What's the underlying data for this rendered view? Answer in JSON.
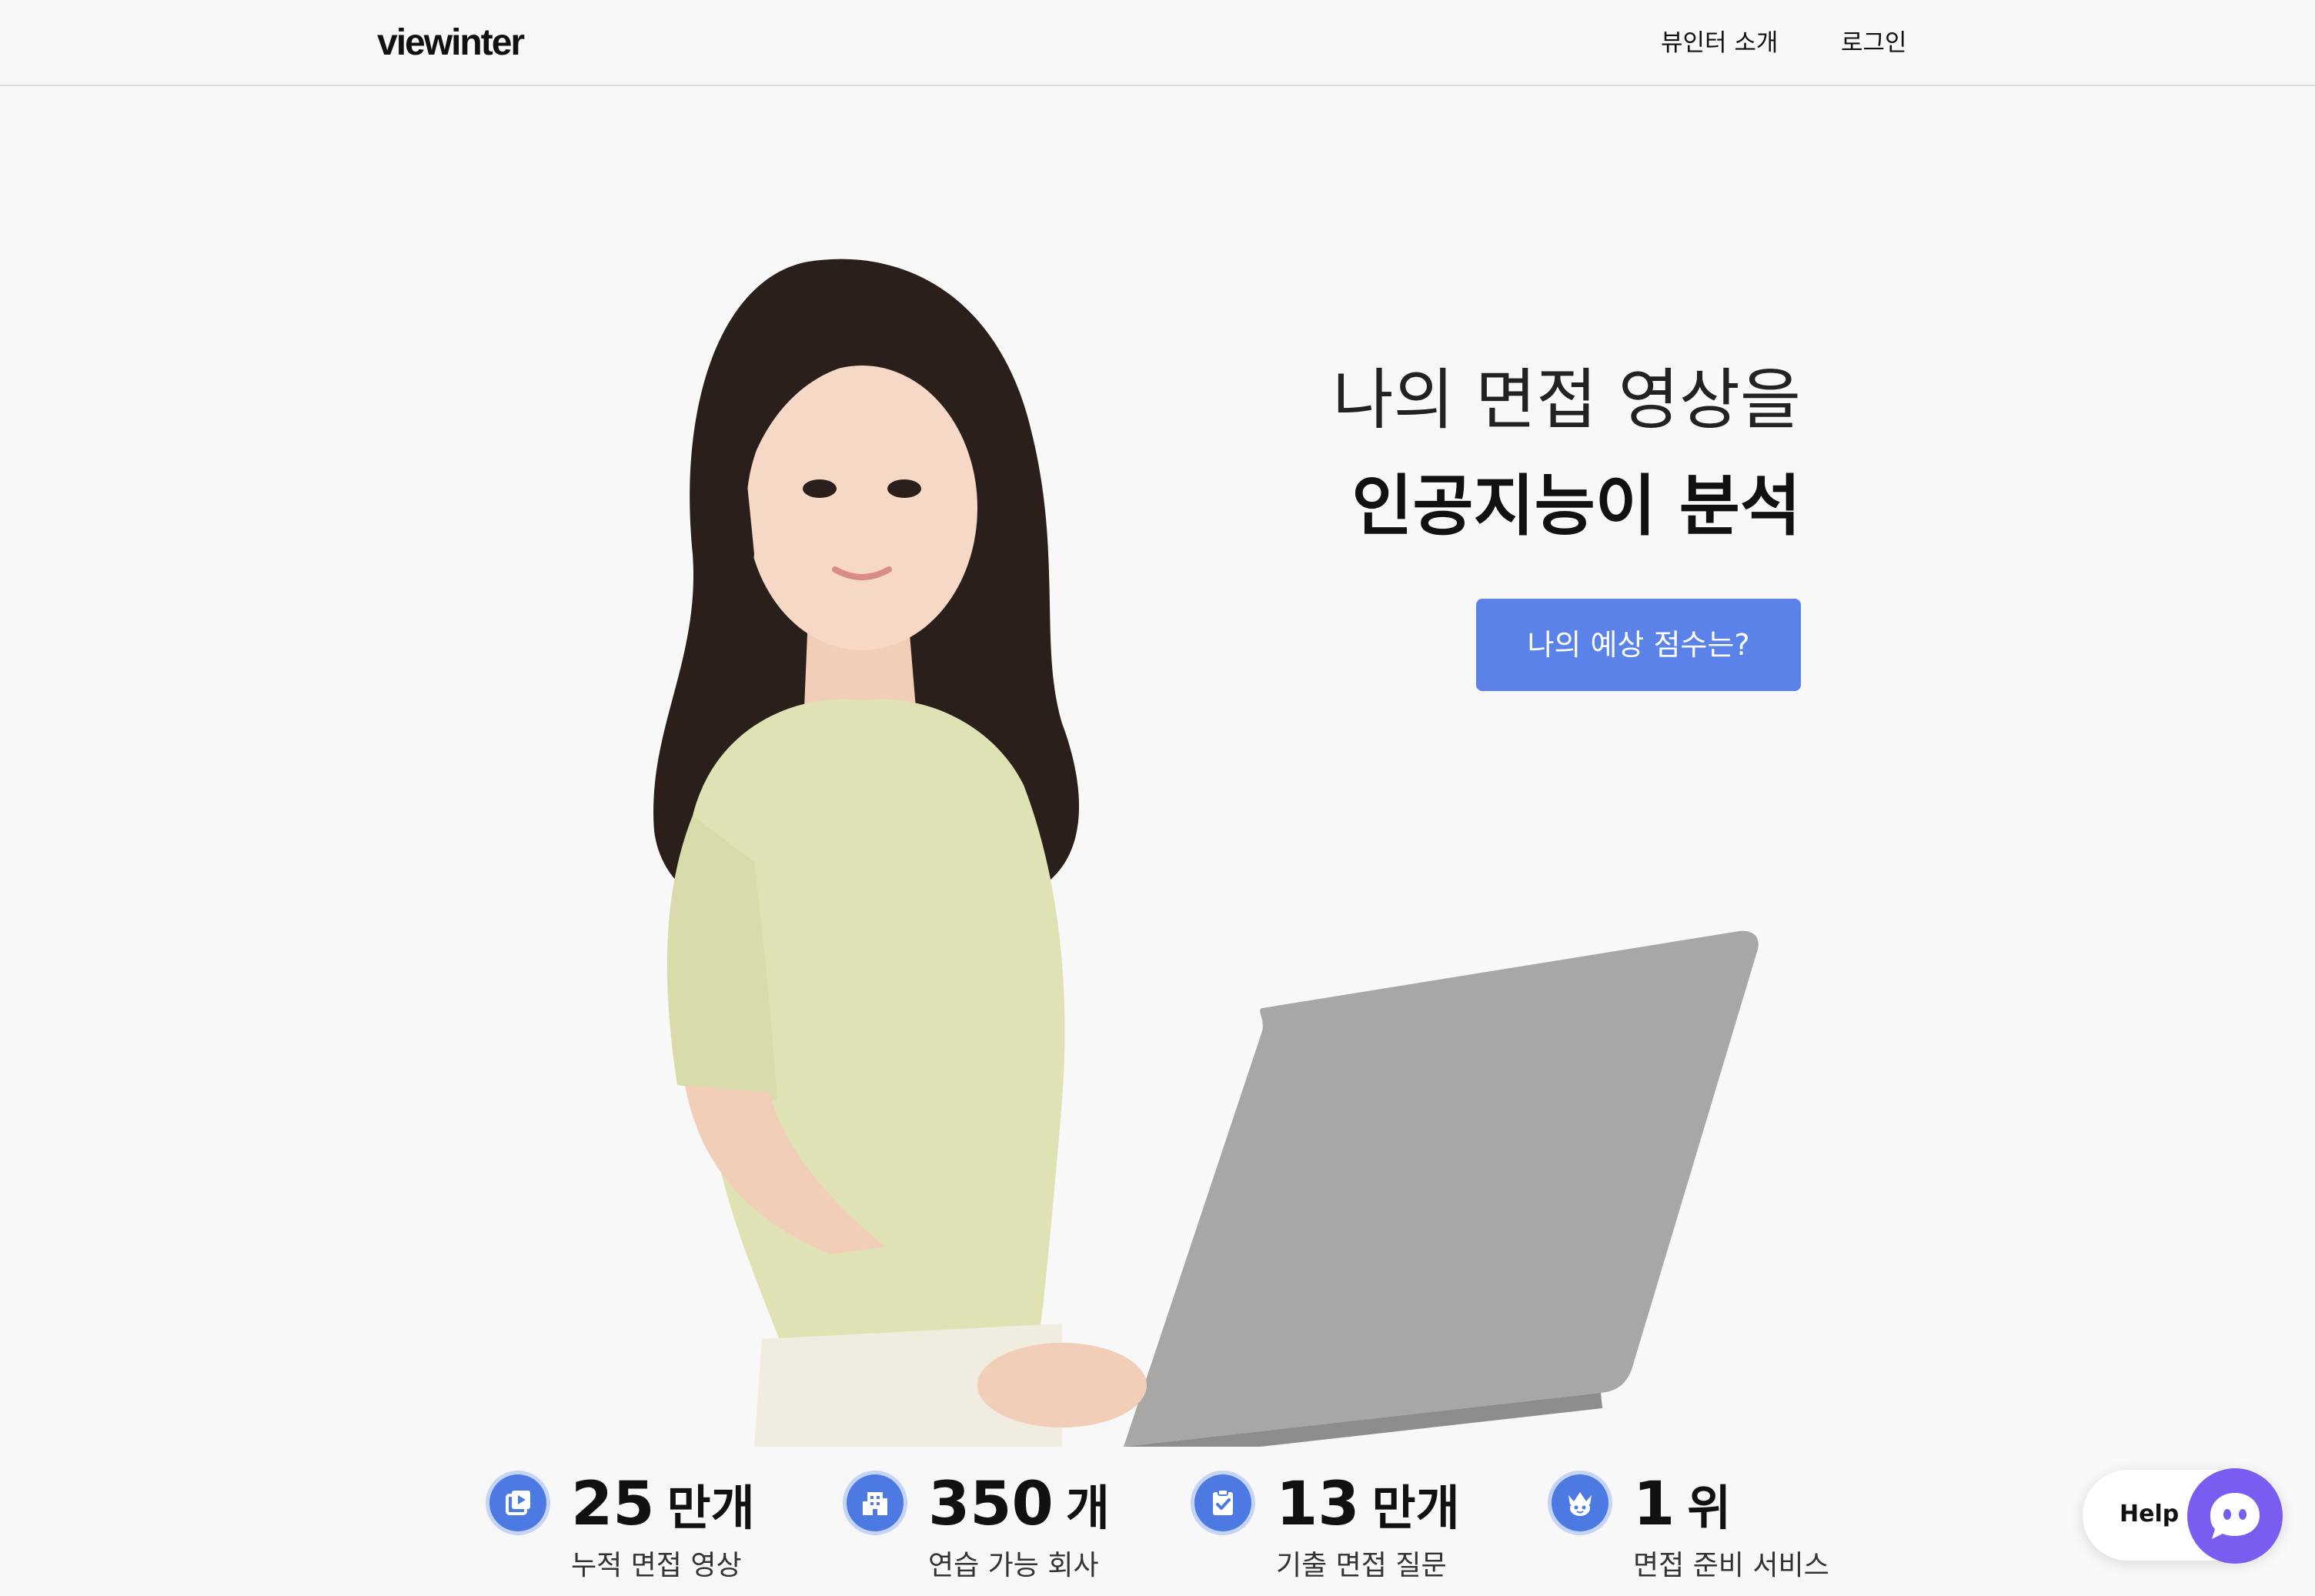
{
  "header": {
    "logo": "viewinter",
    "nav": [
      {
        "label": "뷰인터 소개"
      },
      {
        "label": "로그인"
      }
    ]
  },
  "hero": {
    "line1": "나의 면접 영상을",
    "line2": "인공지능이 분석",
    "cta_label": "나의 예상 점수는?"
  },
  "stats": [
    {
      "icon": "video-icon",
      "number": "25",
      "unit": "만개",
      "label": "누적 면접 영상"
    },
    {
      "icon": "building-icon",
      "number": "350",
      "unit": "개",
      "label": "연습 가능 회사"
    },
    {
      "icon": "clipboard-check-icon",
      "number": "13",
      "unit": "만개",
      "label": "기출 면접 질문"
    },
    {
      "icon": "crown-mascot-icon",
      "number": "1",
      "unit": "위",
      "label": "면접 준비 서비스"
    }
  ],
  "help": {
    "label": "Help",
    "icon": "chat-bubble-icon"
  },
  "colors": {
    "accent": "#5a82e8",
    "icon_blue": "#4d7ae2",
    "help_purple": "#7b5cf0",
    "background": "#f8f8f8"
  }
}
